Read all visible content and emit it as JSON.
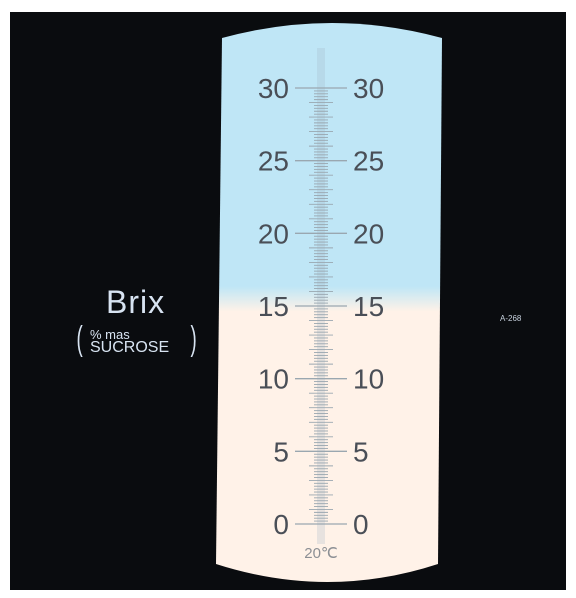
{
  "scale": {
    "unit_label": "Brix",
    "sub_label_line1": "% mas",
    "sub_label_line2": "SUCROSE",
    "paren_open": "(",
    "paren_close": ")",
    "temperature_label": "20℃",
    "model_code": "A-268",
    "min": 0,
    "max": 30,
    "major_step": 5,
    "minor_step": 0.2,
    "shadow_boundary_reading": 15.4,
    "tick_labels": [
      "0",
      "5",
      "10",
      "15",
      "20",
      "25",
      "30"
    ],
    "colors": {
      "field_blue": "#bfe6f6",
      "field_cream": "#fff2e8",
      "surround": "#0a0c0f",
      "text": "#4a4f57"
    }
  }
}
